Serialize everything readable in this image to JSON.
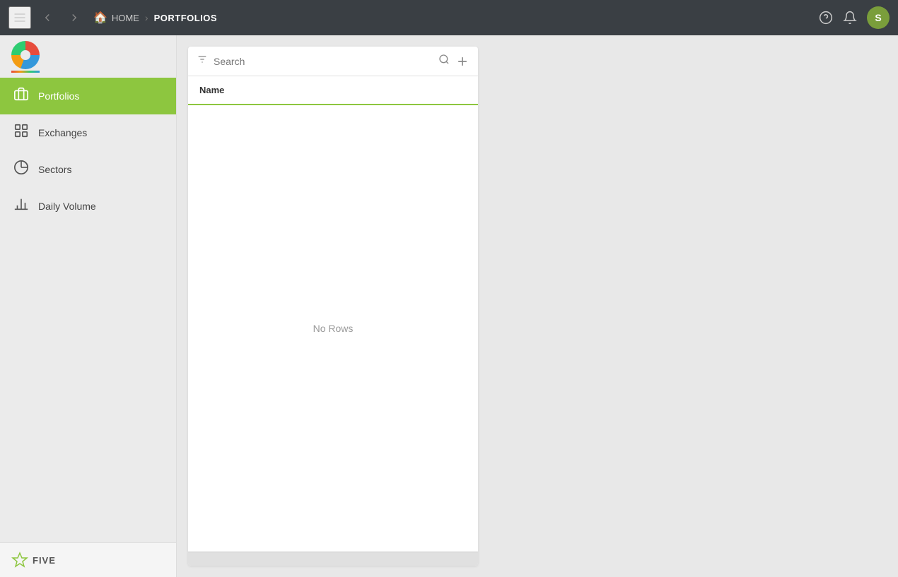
{
  "topbar": {
    "home_label": "HOME",
    "current_page": "PORTFOLIOS",
    "chevron": "›",
    "avatar_letter": "S"
  },
  "sidebar": {
    "items": [
      {
        "id": "portfolios",
        "label": "Portfolios",
        "active": true
      },
      {
        "id": "exchanges",
        "label": "Exchanges",
        "active": false
      },
      {
        "id": "sectors",
        "label": "Sectors",
        "active": false
      },
      {
        "id": "daily-volume",
        "label": "Daily Volume",
        "active": false
      }
    ]
  },
  "panel": {
    "search": {
      "placeholder": "Search"
    },
    "table": {
      "columns": [
        {
          "id": "name",
          "label": "Name"
        }
      ],
      "empty_message": "No Rows"
    }
  },
  "footer": {
    "logo_text": "FIVE"
  }
}
